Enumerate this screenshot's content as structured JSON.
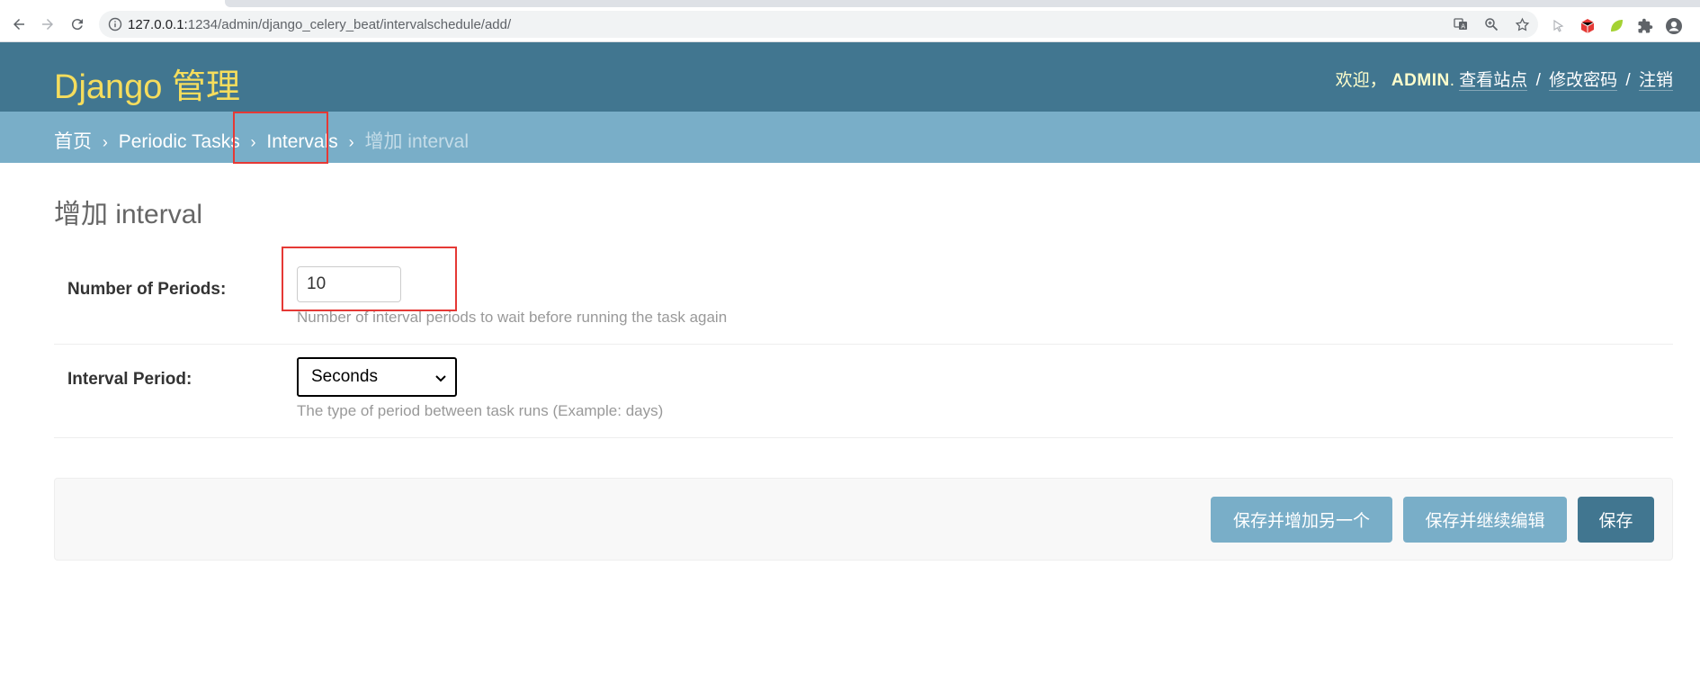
{
  "browser": {
    "url_host": "127.0.0.1:",
    "url_rest": "1234/admin/django_celery_beat/intervalschedule/add/"
  },
  "header": {
    "branding": "Django 管理",
    "welcome": "欢迎，",
    "username": "ADMIN",
    "after_username": ".",
    "view_site": "查看站点",
    "change_password": "修改密码",
    "logout": "注销",
    "separator": "/"
  },
  "breadcrumbs": {
    "home": "首页",
    "app": "Periodic Tasks",
    "model": "Intervals",
    "current": "增加 interval",
    "arrow": "›"
  },
  "page": {
    "title": "增加 interval"
  },
  "form": {
    "every": {
      "label": "Number of Periods:",
      "value": "10",
      "help": "Number of interval periods to wait before running the task again"
    },
    "period": {
      "label": "Interval Period:",
      "selected": "Seconds",
      "help": "The type of period between task runs (Example: days)"
    }
  },
  "submit": {
    "save_add_another": "保存并增加另一个",
    "save_continue": "保存并继续编辑",
    "save": "保存"
  },
  "colors": {
    "header_bg": "#417690",
    "breadcrumbs_bg": "#79aec8",
    "branding": "#f5dd5d",
    "annotation": "#e53935"
  }
}
